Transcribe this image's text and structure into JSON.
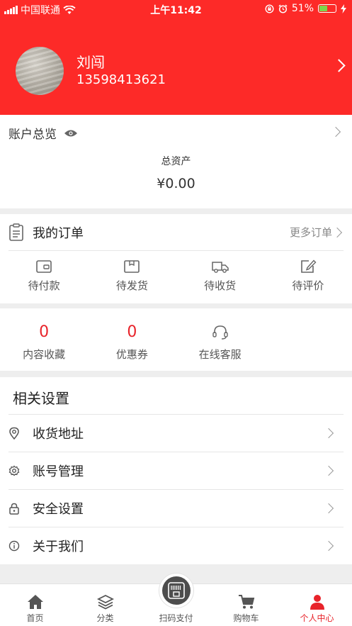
{
  "status_bar": {
    "carrier": "中国联通",
    "time": "上午11:42",
    "battery": "51%",
    "battery_level": 0.51,
    "colors": {
      "bar": "#fd2a28",
      "battery_fill": "#7cd64a"
    }
  },
  "profile": {
    "name": "刘闯",
    "phone": "13598413621",
    "header_color": "#fd2a28"
  },
  "account": {
    "title": "账户总览",
    "asset_label": "总资产",
    "asset_value": "¥0.00"
  },
  "orders": {
    "title": "我的订单",
    "more": "更多订单",
    "items": [
      {
        "label": "待付款",
        "icon": "wallet-icon"
      },
      {
        "label": "待发货",
        "icon": "box-icon"
      },
      {
        "label": "待收货",
        "icon": "truck-icon"
      },
      {
        "label": "待评价",
        "icon": "edit-icon"
      }
    ]
  },
  "stats": {
    "items": [
      {
        "label": "内容收藏",
        "value": "0"
      },
      {
        "label": "优惠券",
        "value": "0"
      },
      {
        "label": "在线客服",
        "icon": "headset-icon"
      }
    ],
    "number_color": "#e8232a"
  },
  "settings": {
    "title": "相关设置",
    "items": [
      {
        "label": "收货地址",
        "icon": "location-icon"
      },
      {
        "label": "账号管理",
        "icon": "gear-icon"
      },
      {
        "label": "安全设置",
        "icon": "lock-icon"
      },
      {
        "label": "关于我们",
        "icon": "info-icon"
      }
    ]
  },
  "tabbar": {
    "tabs": [
      {
        "label": "首页",
        "icon": "home-icon"
      },
      {
        "label": "分类",
        "icon": "layers-icon"
      },
      {
        "label": "扫码支付",
        "icon": "scan-icon"
      },
      {
        "label": "购物车",
        "icon": "cart-icon"
      },
      {
        "label": "个人中心",
        "icon": "user-icon",
        "active": true
      }
    ],
    "active_color": "#e8232a"
  }
}
